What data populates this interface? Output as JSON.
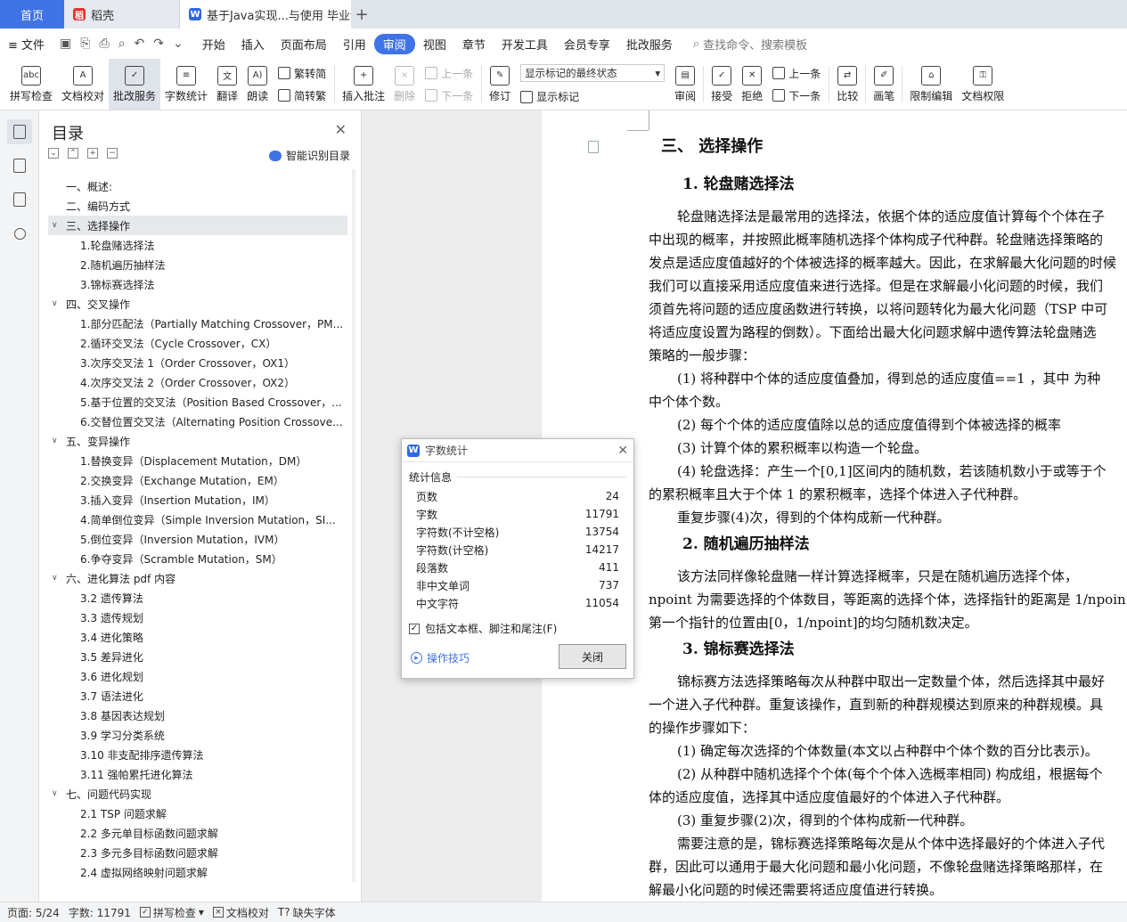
{
  "tabs": {
    "home": "首页",
    "daoke": "稻壳",
    "doc": "基于Java实现...与使用 毕业论",
    "add": "+"
  },
  "menu": {
    "file": "文件",
    "items": [
      "开始",
      "插入",
      "页面布局",
      "引用",
      "审阅",
      "视图",
      "章节",
      "开发工具",
      "会员专享",
      "批改服务"
    ],
    "active_index": 4,
    "search": "查找命令、搜索模板"
  },
  "ribbon": {
    "spell": "拼写检查",
    "proof": "文档校对",
    "correct": "批改服务",
    "wordcount": "字数统计",
    "translate": "翻译",
    "read": "朗读",
    "trad": "繁转简",
    "simp": "简转繁",
    "insert_comment": "插入批注",
    "delete": "删除",
    "prev": "上一条",
    "next": "下一条",
    "revise": "修订",
    "markup_select": "显示标记的最终状态",
    "show_markup": "显示标记",
    "review": "审阅",
    "accept": "接受",
    "reject": "拒绝",
    "prev2": "上一条",
    "next2": "下一条",
    "compare": "比较",
    "pen": "画笔",
    "restrict": "限制编辑",
    "permission": "文档权限"
  },
  "toc": {
    "title": "目录",
    "smart": "智能识别目录",
    "items": [
      {
        "level": 1,
        "text": "一、概述:",
        "arrow": ""
      },
      {
        "level": 1,
        "text": "二、编码方式",
        "arrow": ""
      },
      {
        "level": 1,
        "text": "三、选择操作",
        "arrow": "v",
        "selected": true
      },
      {
        "level": 2,
        "text": "1.轮盘赌选择法",
        "arrow": ""
      },
      {
        "level": 2,
        "text": "2.随机遍历抽样法",
        "arrow": ""
      },
      {
        "level": 2,
        "text": "3.锦标赛选择法",
        "arrow": ""
      },
      {
        "level": 1,
        "text": "四、交叉操作",
        "arrow": "v"
      },
      {
        "level": 2,
        "text": "1.部分匹配法（Partially Matching Crossover，PM...",
        "arrow": ""
      },
      {
        "level": 2,
        "text": "2.循环交叉法（Cycle Crossover，CX）",
        "arrow": ""
      },
      {
        "level": 2,
        "text": "3.次序交叉法 1（Order Crossover，OX1）",
        "arrow": ""
      },
      {
        "level": 2,
        "text": "4.次序交叉法 2（Order Crossover，OX2）",
        "arrow": ""
      },
      {
        "level": 2,
        "text": "5.基于位置的交叉法（Position Based Crossover，...",
        "arrow": ""
      },
      {
        "level": 2,
        "text": "6.交替位置交叉法（Alternating Position Crossove...",
        "arrow": ""
      },
      {
        "level": 1,
        "text": "五、变异操作",
        "arrow": "v"
      },
      {
        "level": 2,
        "text": "1.替换变异（Displacement Mutation，DM）",
        "arrow": ""
      },
      {
        "level": 2,
        "text": "2.交换变异（Exchange Mutation，EM）",
        "arrow": ""
      },
      {
        "level": 2,
        "text": "3.插入变异（Insertion Mutation，IM）",
        "arrow": ""
      },
      {
        "level": 2,
        "text": "4.简单倒位变异（Simple Inversion Mutation，SI...",
        "arrow": ""
      },
      {
        "level": 2,
        "text": "5.倒位变异（Inversion Mutation，IVM）",
        "arrow": ""
      },
      {
        "level": 2,
        "text": "6.争夺变异（Scramble Mutation，SM）",
        "arrow": ""
      },
      {
        "level": 1,
        "text": "六、进化算法 pdf 内容",
        "arrow": "v"
      },
      {
        "level": 2,
        "text": "3.2  遗传算法",
        "arrow": ""
      },
      {
        "level": 2,
        "text": "3.3  遗传规划",
        "arrow": ""
      },
      {
        "level": 2,
        "text": "3.4  进化策略",
        "arrow": ""
      },
      {
        "level": 2,
        "text": "3.5  差异进化",
        "arrow": ""
      },
      {
        "level": 2,
        "text": "3.6  进化规划",
        "arrow": ""
      },
      {
        "level": 2,
        "text": "3.7  语法进化",
        "arrow": ""
      },
      {
        "level": 2,
        "text": "3.8  基因表达规划",
        "arrow": ""
      },
      {
        "level": 2,
        "text": "3.9  学习分类系统",
        "arrow": ""
      },
      {
        "level": 2,
        "text": "3.10  非支配排序遗传算法",
        "arrow": ""
      },
      {
        "level": 2,
        "text": "3.11  强帕累托进化算法",
        "arrow": ""
      },
      {
        "level": 1,
        "text": "七、问题代码实现",
        "arrow": "v"
      },
      {
        "level": 2,
        "text": "2.1 TSP 问题求解",
        "arrow": ""
      },
      {
        "level": 2,
        "text": "2.2  多元单目标函数问题求解",
        "arrow": ""
      },
      {
        "level": 2,
        "text": "2.3  多元多目标函数问题求解",
        "arrow": ""
      },
      {
        "level": 2,
        "text": "2.4  虚拟网络映射问题求解",
        "arrow": ""
      }
    ]
  },
  "document": {
    "blocks": [
      {
        "type": "h2",
        "text": "三、 选择操作"
      },
      {
        "type": "h3",
        "text": "1.  轮盘赌选择法"
      },
      {
        "type": "p",
        "indent": true,
        "text": "轮盘赌选择法是最常用的选择法，依据个体的适应度值计算每个个体在子"
      },
      {
        "type": "p",
        "indent": false,
        "text": "中出现的概率，并按照此概率随机选择个体构成子代种群。轮盘赌选择策略的"
      },
      {
        "type": "p",
        "indent": false,
        "text": "发点是适应度值越好的个体被选择的概率越大。因此，在求解最大化问题的时候"
      },
      {
        "type": "p",
        "indent": false,
        "text": "我们可以直接采用适应度值来进行选择。但是在求解最小化问题的时候，我们"
      },
      {
        "type": "p",
        "indent": false,
        "text": "须首先将问题的适应度函数进行转换，以将问题转化为最大化问题（TSP 中可"
      },
      {
        "type": "p",
        "indent": false,
        "text": "将适应度设置为路程的倒数）。下面给出最大化问题求解中遗传算法轮盘赌选"
      },
      {
        "type": "p",
        "indent": false,
        "text": "策略的一般步骤："
      },
      {
        "type": "p",
        "indent": true,
        "text": "(1) 将种群中个体的适应度值叠加，得到总的适应度值==1 ，其中  为种"
      },
      {
        "type": "p",
        "indent": false,
        "text": "中个体个数。"
      },
      {
        "type": "p",
        "indent": true,
        "text": "(2) 每个个体的适应度值除以总的适应度值得到个体被选择的概率"
      },
      {
        "type": "p",
        "indent": true,
        "text": "(3) 计算个体的累积概率以构造一个轮盘。"
      },
      {
        "type": "p",
        "indent": true,
        "text": "(4) 轮盘选择：产生一个[0,1]区间内的随机数，若该随机数小于或等于个"
      },
      {
        "type": "p",
        "indent": false,
        "text": "的累积概率且大于个体 1 的累积概率，选择个体进入子代种群。"
      },
      {
        "type": "p",
        "indent": true,
        "text": "重复步骤(4)次，得到的个体构成新一代种群。"
      },
      {
        "type": "h3",
        "text": "2.  随机遍历抽样法"
      },
      {
        "type": "p",
        "indent": true,
        "text": "该方法同样像轮盘赌一样计算选择概率，只是在随机遍历选择个体，"
      },
      {
        "type": "p",
        "indent": false,
        "text": "npoint 为需要选择的个体数目，等距离的选择个体，选择指针的距离是 1/npoin"
      },
      {
        "type": "p",
        "indent": false,
        "text": "第一个指针的位置由[0，1/npoint]的均匀随机数决定。"
      },
      {
        "type": "h3",
        "text": "3.  锦标赛选择法"
      },
      {
        "type": "p",
        "indent": true,
        "text": "锦标赛方法选择策略每次从种群中取出一定数量个体，然后选择其中最好"
      },
      {
        "type": "p",
        "indent": false,
        "text": "一个进入子代种群。重复该操作，直到新的种群规模达到原来的种群规模。具"
      },
      {
        "type": "p",
        "indent": false,
        "text": "的操作步骤如下："
      },
      {
        "type": "p",
        "indent": true,
        "text": "(1) 确定每次选择的个体数量(本文以占种群中个体个数的百分比表示)。"
      },
      {
        "type": "p",
        "indent": true,
        "text": "(2) 从种群中随机选择个个体(每个个体入选概率相同) 构成组，根据每个"
      },
      {
        "type": "p",
        "indent": false,
        "text": "体的适应度值，选择其中适应度值最好的个体进入子代种群。"
      },
      {
        "type": "p",
        "indent": true,
        "text": "(3) 重复步骤(2)次，得到的个体构成新一代种群。"
      },
      {
        "type": "p",
        "indent": true,
        "text": "需要注意的是，锦标赛选择策略每次是从个体中选择最好的个体进入子代"
      },
      {
        "type": "p",
        "indent": false,
        "text": "群，因此可以通用于最大化问题和最小化问题，不像轮盘赌选择策略那样，在"
      },
      {
        "type": "p",
        "indent": false,
        "text": "解最小化问题的时候还需要将适应度值进行转换。"
      }
    ]
  },
  "dialog": {
    "title": "字数统计",
    "section": "统计信息",
    "rows": [
      {
        "label": "页数",
        "value": "24"
      },
      {
        "label": "字数",
        "value": "11791"
      },
      {
        "label": "字符数(不计空格)",
        "value": "13754"
      },
      {
        "label": "字符数(计空格)",
        "value": "14217"
      },
      {
        "label": "段落数",
        "value": "411"
      },
      {
        "label": "非中文单词",
        "value": "737"
      },
      {
        "label": "中文字符",
        "value": "11054"
      }
    ],
    "checkbox": "包括文本框、脚注和尾注(F)",
    "tips": "操作技巧",
    "close": "关闭"
  },
  "status": {
    "page": "页面: 5/24",
    "words": "字数: 11791",
    "spell": "拼写检查",
    "proof": "文档校对",
    "missing_font": "缺失字体"
  }
}
